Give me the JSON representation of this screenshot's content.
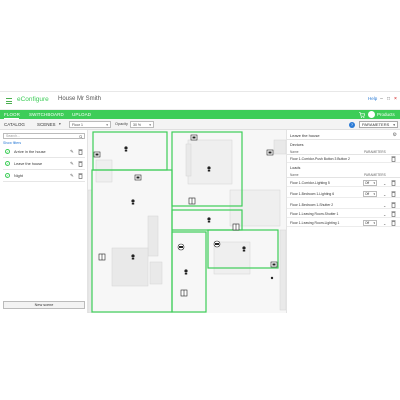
{
  "app": {
    "name": "eConfigure",
    "project": "House Mr Smith",
    "help": "Help",
    "minimize": "–",
    "maximize": "□",
    "close": "×"
  },
  "nav": {
    "floor": "FLOOR",
    "switchboard": "SWITCHBOARD",
    "upload": "UPLOAD",
    "products": "Products"
  },
  "toolbar": {
    "catalog": "CATALOG",
    "scenes": "SCENES",
    "floor_select": "Floor 1",
    "opacity_label": "Opacity",
    "opacity_value": "30 %",
    "help": "?",
    "parameters": "PARAMETERS"
  },
  "left": {
    "search_placeholder": "Search...",
    "show_filters": "Show filters",
    "scenes": [
      {
        "name": "Arrive in the house"
      },
      {
        "name": "Leave the house"
      },
      {
        "name": "Night"
      }
    ],
    "new_scene": "New scene"
  },
  "right": {
    "scene_title": "Leave the house",
    "devices_title": "Devices",
    "loads_title": "Loads",
    "col_name": "Name",
    "col_params": "PARAMETERS",
    "devices": [
      {
        "name": "Floor 1-Corridor-Push Button 3 Button 2"
      }
    ],
    "loads": [
      {
        "name": "Floor 1-Corridor-Lighting 5",
        "value": "Off"
      },
      {
        "name": "Floor 1-Bedroom 1-Lighting 6",
        "value": "Off"
      },
      {
        "name": "Floor 1-Bedroom 1-Shutter 2",
        "value": ""
      },
      {
        "name": "Floor 1-Leaving Room-Shutter 1",
        "value": ""
      },
      {
        "name": "Floor 1-Leaving Room-Lighting 1",
        "value": "Off"
      }
    ]
  },
  "colors": {
    "brand_green": "#3dcd58",
    "link_blue": "#2a7ad5"
  },
  "icons": {
    "menu": "hamburger-icon",
    "cart": "cart-icon",
    "search": "search-icon",
    "check": "check-icon",
    "edit": "pencil-icon",
    "delete": "trash-icon",
    "settings": "gear-icon",
    "plan_devices": [
      "bulb-icon",
      "push-button-icon",
      "shutter-icon",
      "sensor-icon"
    ]
  }
}
